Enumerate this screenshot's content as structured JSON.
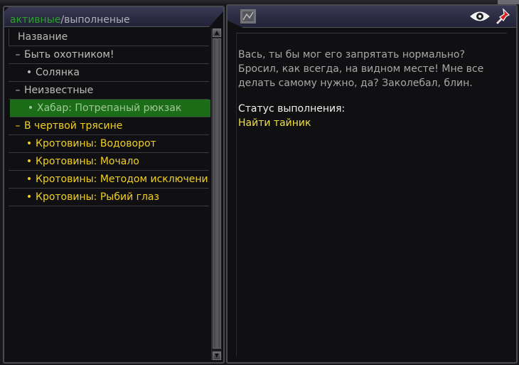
{
  "tabs": {
    "active": "активные",
    "separator": "/",
    "completed": "выполненые"
  },
  "list": {
    "header": "Название",
    "rows": [
      {
        "mark": "–",
        "label": "Быть охотником!",
        "level": 1,
        "color": "#bdbdbd",
        "selected": false
      },
      {
        "mark": "•",
        "label": "Солянка",
        "level": 2,
        "color": "#bdbdbd",
        "selected": false
      },
      {
        "mark": "–",
        "label": "Неизвестные",
        "level": 1,
        "color": "#bdbdbd",
        "selected": false
      },
      {
        "mark": "•",
        "label": "Хабар: Потрепаный рюкзак",
        "level": 2,
        "color": "#9fc89a",
        "selected": true
      },
      {
        "mark": "–",
        "label": "В чертвой трясине",
        "level": 1,
        "color": "#f2d020",
        "selected": false
      },
      {
        "mark": "•",
        "label": "Кротовины: Водоворот",
        "level": 2,
        "color": "#f2d020",
        "selected": false
      },
      {
        "mark": "•",
        "label": "Кротовины: Мочало",
        "level": 2,
        "color": "#f2d020",
        "selected": false
      },
      {
        "mark": "•",
        "label": "Кротовины: Методом исключения",
        "level": 2,
        "color": "#f2d020",
        "selected": false
      },
      {
        "mark": "•",
        "label": "Кротовины: Рыбий глаз",
        "level": 2,
        "color": "#f2d020",
        "selected": false
      }
    ]
  },
  "details": {
    "description": "Вась, ты бы мог его запрятать нормально?\nБросил, как всегда, на видном месте! Мне все\nделать самому нужно, да? Заколебал, блин.",
    "status_label": "Статус выполнения:",
    "status_value": "Найти тайник"
  },
  "icons": {
    "map": "map-icon",
    "eye": "eye-icon",
    "pin": "pin-icon"
  },
  "colors": {
    "active_tab": "#2fa02f",
    "selected_row_bg": "#1c6d18",
    "highlight_yellow": "#f2d020",
    "pin_red": "#d42020"
  }
}
